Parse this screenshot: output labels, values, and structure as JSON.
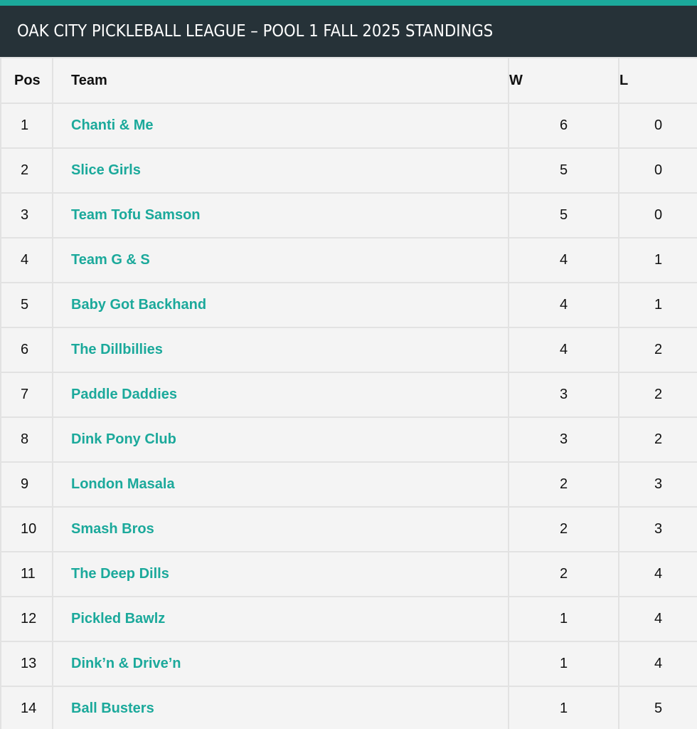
{
  "colors": {
    "accent": "#1ba99b",
    "header_bg": "#263238",
    "table_bg": "#f4f4f4",
    "border": "#e2e2e2"
  },
  "header": {
    "title": "OAK CITY PICKLEBALL LEAGUE – POOL 1 FALL 2025 STANDINGS"
  },
  "table": {
    "columns": [
      "Pos",
      "Team",
      "W",
      "L"
    ],
    "rows": [
      {
        "pos": "1",
        "team": "Chanti & Me",
        "w": "6",
        "l": "0"
      },
      {
        "pos": "2",
        "team": "Slice Girls",
        "w": "5",
        "l": "0"
      },
      {
        "pos": "3",
        "team": "Team Tofu Samson",
        "w": "5",
        "l": "0"
      },
      {
        "pos": "4",
        "team": "Team G & S",
        "w": "4",
        "l": "1"
      },
      {
        "pos": "5",
        "team": "Baby Got Backhand",
        "w": "4",
        "l": "1"
      },
      {
        "pos": "6",
        "team": "The Dillbillies",
        "w": "4",
        "l": "2"
      },
      {
        "pos": "7",
        "team": "Paddle Daddies",
        "w": "3",
        "l": "2"
      },
      {
        "pos": "8",
        "team": "Dink Pony Club",
        "w": "3",
        "l": "2"
      },
      {
        "pos": "9",
        "team": "London Masala",
        "w": "2",
        "l": "3"
      },
      {
        "pos": "10",
        "team": "Smash Bros",
        "w": "2",
        "l": "3"
      },
      {
        "pos": "11",
        "team": "The Deep Dills",
        "w": "2",
        "l": "4"
      },
      {
        "pos": "12",
        "team": "Pickled Bawlz",
        "w": "1",
        "l": "4"
      },
      {
        "pos": "13",
        "team": "Dink’n & Drive’n",
        "w": "1",
        "l": "4"
      },
      {
        "pos": "14",
        "team": "Ball Busters",
        "w": "1",
        "l": "5"
      }
    ]
  }
}
